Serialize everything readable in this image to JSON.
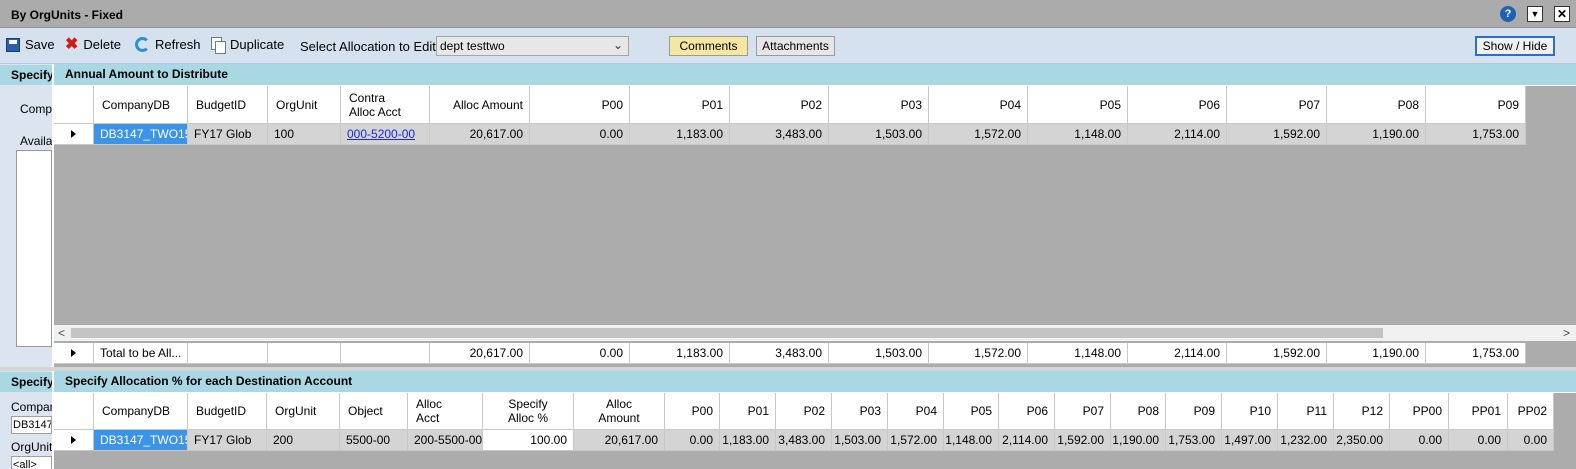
{
  "window": {
    "title": "By OrgUnits - Fixed"
  },
  "toolbar": {
    "save_label": "Save",
    "delete_label": "Delete",
    "refresh_label": "Refresh",
    "duplicate_label": "Duplicate",
    "select_label": "Select Allocation to Edit",
    "selected_allocation": "dept testtwo",
    "comments_label": "Comments",
    "attachments_label": "Attachments",
    "show_hide_label": "Show / Hide"
  },
  "left_top": {
    "header": "Specify",
    "label1": "Compa",
    "label2": "Availal"
  },
  "left_bottom": {
    "header": "Specify",
    "label1": "Compan",
    "field1": "DB3147",
    "label2": "OrgUnit",
    "field2": "<all>"
  },
  "top_section": {
    "header": "Annual Amount to Distribute",
    "columns": [
      "CompanyDB",
      "BudgetID",
      "OrgUnit",
      "Contra\nAlloc Acct",
      "Alloc Amount",
      "P00",
      "P01",
      "P02",
      "P03",
      "P04",
      "P05",
      "P06",
      "P07",
      "P08",
      "P09"
    ],
    "row": [
      "DB3147_TWO15",
      "FY17 Glob",
      "100",
      "000-5200-00",
      "20,617.00",
      "0.00",
      "1,183.00",
      "3,483.00",
      "1,503.00",
      "1,572.00",
      "1,148.00",
      "2,114.00",
      "1,592.00",
      "1,190.00",
      "1,753.00"
    ],
    "total_row": [
      "Total to be All...",
      "",
      "",
      "",
      "20,617.00",
      "0.00",
      "1,183.00",
      "3,483.00",
      "1,503.00",
      "1,572.00",
      "1,148.00",
      "2,114.00",
      "1,592.00",
      "1,190.00",
      "1,753.00"
    ]
  },
  "bottom_section": {
    "header": "Specify Allocation % for each Destination Account",
    "columns": [
      "CompanyDB",
      "BudgetID",
      "OrgUnit",
      "Object",
      "Alloc\nAcct",
      "Specify\nAlloc %",
      "Alloc\nAmount",
      "P00",
      "P01",
      "P02",
      "P03",
      "P04",
      "P05",
      "P06",
      "P07",
      "P08",
      "P09",
      "P10",
      "P11",
      "P12",
      "PP00",
      "PP01",
      "PP02"
    ],
    "row": [
      "DB3147_TWO15",
      "FY17 Glob",
      "200",
      "5500-00",
      "200-5500-00",
      "100.00",
      "20,617.00",
      "0.00",
      "1,183.00",
      "3,483.00",
      "1,503.00",
      "1,572.00",
      "1,148.00",
      "2,114.00",
      "1,592.00",
      "1,190.00",
      "1,753.00",
      "1,497.00",
      "1,232.00",
      "2,350.00",
      "0.00",
      "0.00",
      "0.00"
    ]
  }
}
